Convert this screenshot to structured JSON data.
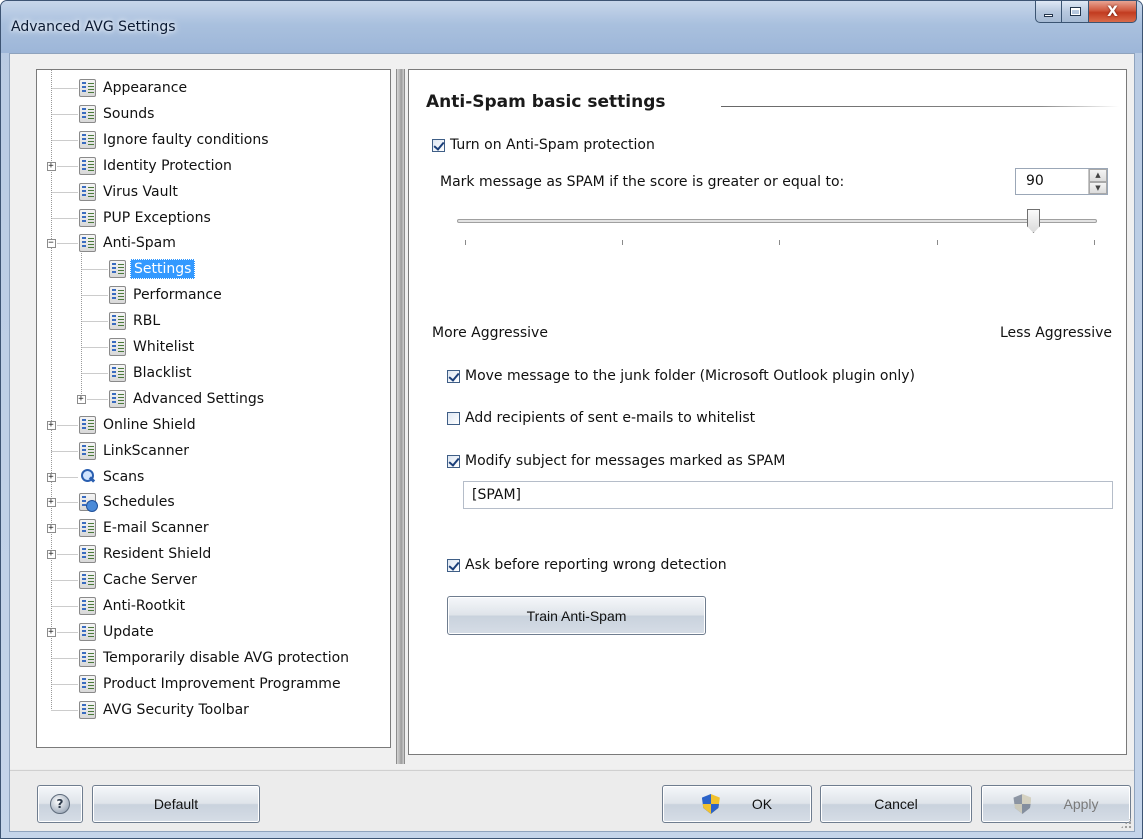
{
  "window": {
    "title": "Advanced AVG Settings",
    "controls": {
      "minimize": "—",
      "maximize": "□",
      "close": "X"
    }
  },
  "tree": {
    "items": [
      {
        "label": "Appearance",
        "icon": "settings-page-icon",
        "level": 0,
        "expander": null
      },
      {
        "label": "Sounds",
        "icon": "settings-page-icon",
        "level": 0,
        "expander": null
      },
      {
        "label": "Ignore faulty conditions",
        "icon": "settings-page-icon",
        "level": 0,
        "expander": null
      },
      {
        "label": "Identity Protection",
        "icon": "settings-page-icon",
        "level": 0,
        "expander": "+"
      },
      {
        "label": "Virus Vault",
        "icon": "settings-page-icon",
        "level": 0,
        "expander": null
      },
      {
        "label": "PUP Exceptions",
        "icon": "settings-page-icon",
        "level": 0,
        "expander": null
      },
      {
        "label": "Anti-Spam",
        "icon": "settings-page-icon",
        "level": 0,
        "expander": "−"
      },
      {
        "label": "Settings",
        "icon": "settings-page-icon",
        "level": 1,
        "expander": null,
        "selected": true
      },
      {
        "label": "Performance",
        "icon": "settings-page-icon",
        "level": 1,
        "expander": null
      },
      {
        "label": "RBL",
        "icon": "settings-page-icon",
        "level": 1,
        "expander": null
      },
      {
        "label": "Whitelist",
        "icon": "settings-page-icon",
        "level": 1,
        "expander": null
      },
      {
        "label": "Blacklist",
        "icon": "settings-page-icon",
        "level": 1,
        "expander": null
      },
      {
        "label": "Advanced Settings",
        "icon": "settings-page-icon",
        "level": 1,
        "expander": "+"
      },
      {
        "label": "Online Shield",
        "icon": "settings-page-icon",
        "level": 0,
        "expander": "+"
      },
      {
        "label": "LinkScanner",
        "icon": "settings-page-icon",
        "level": 0,
        "expander": null
      },
      {
        "label": "Scans",
        "icon": "magnifier-icon",
        "level": 0,
        "expander": "+"
      },
      {
        "label": "Schedules",
        "icon": "schedule-clock-icon",
        "level": 0,
        "expander": "+"
      },
      {
        "label": "E-mail Scanner",
        "icon": "settings-page-icon",
        "level": 0,
        "expander": "+"
      },
      {
        "label": "Resident Shield",
        "icon": "settings-page-icon",
        "level": 0,
        "expander": "+"
      },
      {
        "label": "Cache Server",
        "icon": "settings-page-icon",
        "level": 0,
        "expander": null
      },
      {
        "label": "Anti-Rootkit",
        "icon": "settings-page-icon",
        "level": 0,
        "expander": null
      },
      {
        "label": "Update",
        "icon": "settings-page-icon",
        "level": 0,
        "expander": "+"
      },
      {
        "label": "Temporarily disable AVG protection",
        "icon": "settings-page-icon",
        "level": 0,
        "expander": null
      },
      {
        "label": "Product Improvement Programme",
        "icon": "settings-page-icon",
        "level": 0,
        "expander": null
      },
      {
        "label": "AVG Security Toolbar",
        "icon": "settings-page-icon",
        "level": 0,
        "expander": null
      }
    ]
  },
  "settings": {
    "section_title": "Anti-Spam basic settings",
    "turn_on": {
      "label": "Turn on Anti-Spam protection",
      "checked": true
    },
    "score_label": "Mark message as SPAM if the score is greater or equal to:",
    "score_value": "90",
    "slider": {
      "value": 90,
      "min": 0,
      "max": 100,
      "left_label": "More Aggressive",
      "right_label": "Less Aggressive"
    },
    "move_junk": {
      "label": "Move message to the junk folder (Microsoft Outlook plugin only)",
      "checked": true
    },
    "add_recipients": {
      "label": "Add recipients of sent e-mails to whitelist",
      "checked": false
    },
    "modify_subject": {
      "label": "Modify subject for messages marked as SPAM",
      "checked": true
    },
    "subject_text": "[SPAM]",
    "ask_before": {
      "label": "Ask before reporting wrong detection",
      "checked": true
    },
    "train_button": "Train Anti-Spam"
  },
  "footer": {
    "help_glyph": "?",
    "default_button": "Default",
    "ok_button": "OK",
    "cancel_button": "Cancel",
    "apply_button": "Apply",
    "apply_enabled": false
  }
}
